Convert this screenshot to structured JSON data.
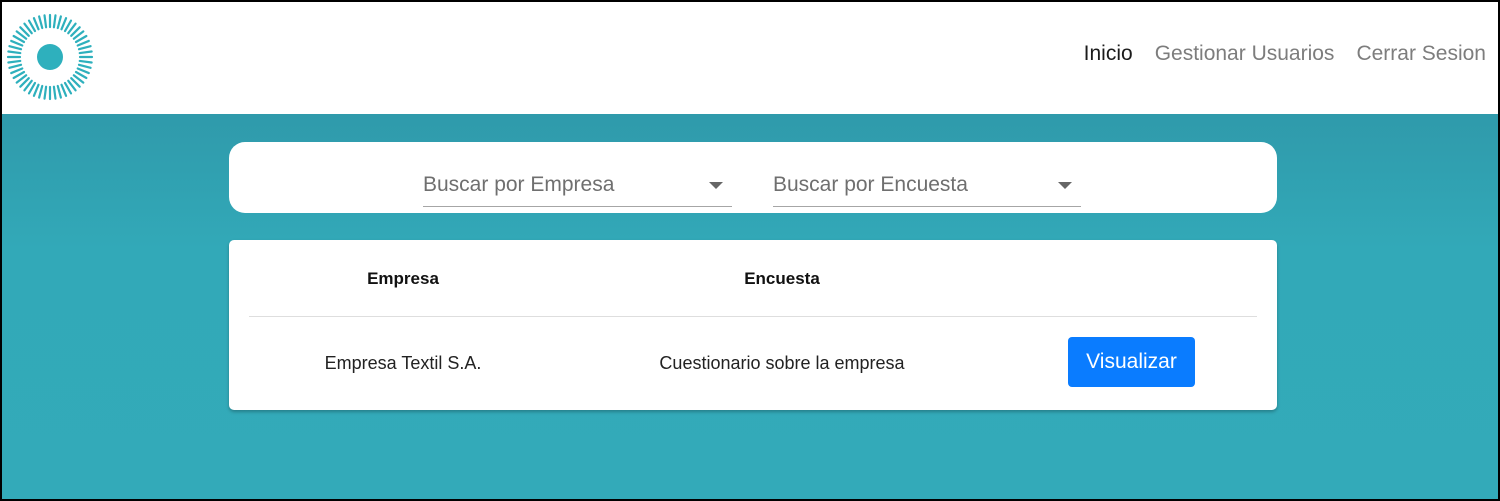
{
  "navbar": {
    "logo_icon": "sun-ring-logo-icon",
    "links": [
      {
        "label": "Inicio",
        "active": true
      },
      {
        "label": "Gestionar Usuarios",
        "active": false
      },
      {
        "label": "Cerrar Sesion",
        "active": false
      }
    ]
  },
  "filters": {
    "empresa_placeholder": "Buscar por Empresa",
    "encuesta_placeholder": "Buscar por Encuesta"
  },
  "table": {
    "headers": [
      "Empresa",
      "Encuesta",
      ""
    ],
    "rows": [
      {
        "empresa": "Empresa Textil S.A.",
        "encuesta": "Cuestionario sobre la empresa",
        "action_label": "Visualizar"
      }
    ]
  },
  "colors": {
    "accent": "#33aab9",
    "logo": "#2eb0bd",
    "button": "#0a7cff"
  }
}
